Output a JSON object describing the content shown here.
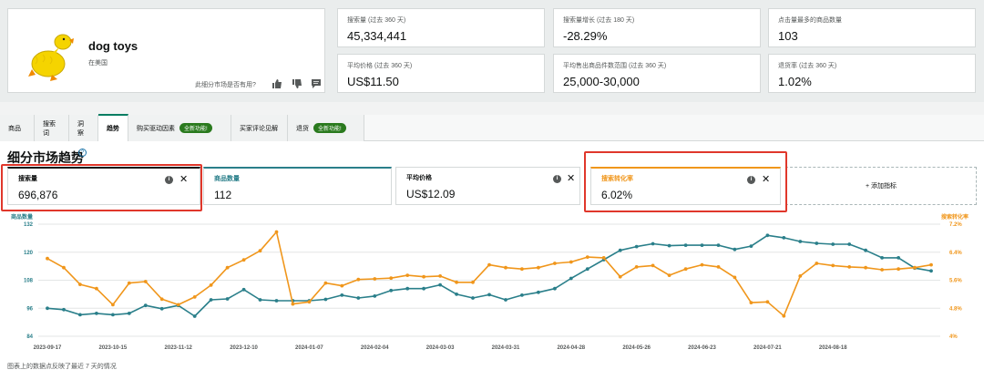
{
  "product": {
    "title": "dog toys",
    "region": "在美国",
    "useful_question": "此细分市场是否有用?"
  },
  "metrics": [
    {
      "label": "搜索量 (过去 360 天)",
      "value": "45,334,441"
    },
    {
      "label": "搜索量增长 (过去 180 天)",
      "value": "-28.29%"
    },
    {
      "label": "点击量最多的商品数量",
      "value": "103"
    },
    {
      "label": "平均价格 (过去 360 天)",
      "value": "US$11.50"
    },
    {
      "label": "平均售出商品件数范围 (过去 360 天)",
      "value": "25,000-30,000"
    },
    {
      "label": "退货率 (过去 360 天)",
      "value": "1.02%"
    }
  ],
  "tabs": [
    {
      "label": "商品"
    },
    {
      "label": "搜索词"
    },
    {
      "label": "洞察"
    },
    {
      "label": "趋势"
    },
    {
      "label": "购买驱动因素",
      "badge": "全新功能!"
    },
    {
      "label": "买家评论见解"
    },
    {
      "label": "退货",
      "badge": "全新功能!"
    }
  ],
  "active_tab": "趋势",
  "section_title": "细分市场趋势",
  "trend_cards": [
    {
      "label": "搜索量",
      "value": "696,876",
      "color": "#0f1111"
    },
    {
      "label": "商品数量",
      "value": "112",
      "color": "#2a7f8a"
    },
    {
      "label": "平均价格",
      "value": "US$12.09",
      "color": "#0f1111"
    },
    {
      "label": "搜索转化率",
      "value": "6.02%",
      "color": "#f0961b"
    }
  ],
  "add_metric": "+ 添加指标",
  "footnote": "图表上的数据点反映了最近 7 天的情况",
  "colors": {
    "teal": "#2a7f8a",
    "orange": "#f0961b",
    "highlight": "#e0372b"
  },
  "chart_data": {
    "type": "line",
    "left_axis_label": "商品数量",
    "right_axis_label": "搜索转化率",
    "left_ticks": [
      "132",
      "120",
      "108",
      "96",
      "84"
    ],
    "right_ticks": [
      "7.2%",
      "6.4%",
      "5.6%",
      "4.8%",
      "4%"
    ],
    "ylim_left": [
      84,
      132
    ],
    "ylim_right": [
      4.0,
      7.2
    ],
    "x_ticks": [
      "2023-09-17",
      "2023-10-15",
      "2023-11-12",
      "2023-12-10",
      "2024-01-07",
      "2024-02-04",
      "2024-03-03",
      "2024-03-31",
      "2024-04-28",
      "2024-05-26",
      "2024-06-23",
      "2024-07-21",
      "2024-08-18"
    ],
    "x_tick_index": [
      0,
      4,
      8,
      12,
      16,
      20,
      24,
      28,
      32,
      36,
      40,
      44,
      48
    ],
    "series": [
      {
        "name": "商品数量",
        "color": "#2a7f8a",
        "values": [
          96,
          95.4,
          93.2,
          93.8,
          93.2,
          93.8,
          97.2,
          95.8,
          97.2,
          92.6,
          99.6,
          100,
          104,
          99.6,
          99.2,
          99.2,
          99.2,
          99.8,
          101.6,
          100.4,
          101.2,
          103.6,
          104.4,
          104.4,
          106,
          102,
          100.4,
          101.8,
          99.6,
          101.6,
          102.8,
          104.4,
          108.8,
          112.8,
          116.8,
          120.8,
          122.4,
          123.6,
          122.8,
          123,
          123,
          123,
          121.2,
          122.6,
          127.2,
          126.2,
          124.6,
          123.8,
          123.4,
          123.4,
          120.8,
          117.6,
          117.6,
          113.2,
          112
        ]
      },
      {
        "name": "搜索转化率",
        "color": "#f0961b",
        "values": [
          6.22,
          5.96,
          5.48,
          5.36,
          4.9,
          5.52,
          5.56,
          5.06,
          4.9,
          5.12,
          5.46,
          5.96,
          6.18,
          6.44,
          6.98,
          4.92,
          4.98,
          5.52,
          5.44,
          5.62,
          5.64,
          5.66,
          5.74,
          5.7,
          5.72,
          5.54,
          5.54,
          6.04,
          5.96,
          5.92,
          5.96,
          6.08,
          6.12,
          6.26,
          6.24,
          5.7,
          5.98,
          6.02,
          5.74,
          5.92,
          6.04,
          5.98,
          5.68,
          4.96,
          4.98,
          4.58,
          5.72,
          6.08,
          6.02,
          5.98,
          5.96,
          5.9,
          5.92,
          5.96,
          6.04
        ]
      }
    ]
  }
}
